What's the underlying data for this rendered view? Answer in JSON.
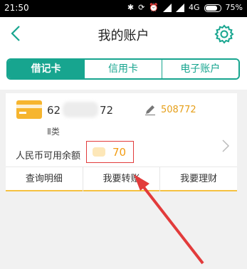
{
  "status_bar": {
    "time": "21:50",
    "network": "4G",
    "battery": "75%"
  },
  "header": {
    "title": "我的账户"
  },
  "tabs": [
    {
      "label": "借记卡",
      "active": true
    },
    {
      "label": "信用卡",
      "active": false
    },
    {
      "label": "电子账户",
      "active": false
    }
  ],
  "card": {
    "account_prefix": "62",
    "account_suffix": "72",
    "alias": "508772",
    "card_type": "Ⅱ类",
    "balance_label": "人民币可用余额",
    "balance_value": "70"
  },
  "actions": [
    {
      "label": "查询明细"
    },
    {
      "label": "我要转账"
    },
    {
      "label": "我要理财"
    }
  ],
  "colors": {
    "accent": "#17a58f",
    "highlight": "#f39c12",
    "annotation": "#e23b3b"
  }
}
